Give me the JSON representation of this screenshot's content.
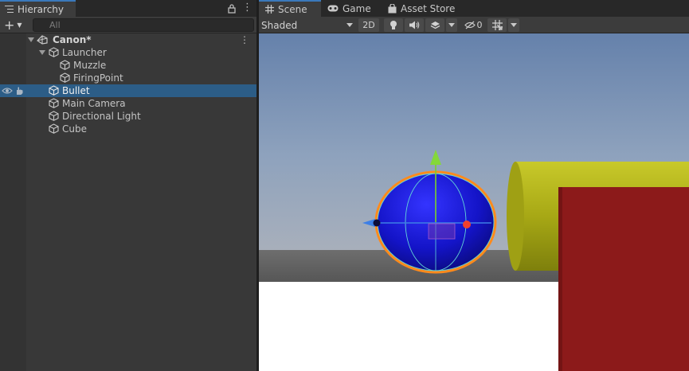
{
  "hierarchy": {
    "tab_label": "Hierarchy",
    "add_label": "+",
    "search_placeholder": "All",
    "items": [
      {
        "label": "Canon*",
        "kind": "scene"
      },
      {
        "label": "Launcher",
        "kind": "parent"
      },
      {
        "label": "Muzzle",
        "kind": "child"
      },
      {
        "label": "FiringPoint",
        "kind": "child"
      },
      {
        "label": "Bullet",
        "kind": "object",
        "selected": true
      },
      {
        "label": "Main Camera",
        "kind": "object"
      },
      {
        "label": "Directional Light",
        "kind": "object"
      },
      {
        "label": "Cube",
        "kind": "object"
      }
    ]
  },
  "scene": {
    "tabs": [
      {
        "label": "Scene",
        "active": true
      },
      {
        "label": "Game",
        "active": false
      },
      {
        "label": "Asset Store",
        "active": false
      }
    ],
    "shading_mode": "Shaded",
    "mode_2d": "2D",
    "hidden_count": "0"
  },
  "colors": {
    "selection": "#2c5d87",
    "accent_tab": "#3a79bb",
    "sphere": "#1818d8",
    "cylinder": "#b5b716",
    "cube": "#8c1a1a"
  }
}
